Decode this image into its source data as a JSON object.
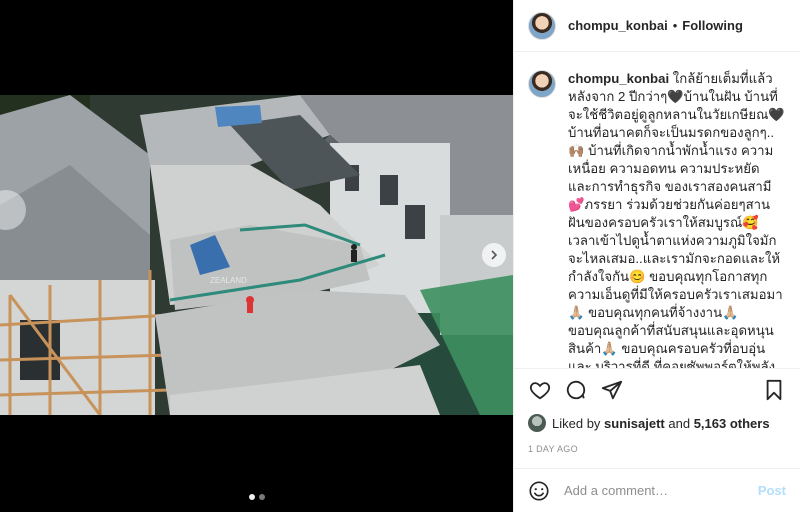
{
  "media": {
    "image_alt": "",
    "watermark": "ZEALAND"
  },
  "header": {
    "username": "chompu_konbai",
    "separator": "•",
    "follow_status": "Following"
  },
  "caption": {
    "username": "chompu_konbai",
    "text": " ใกล้ย้ายเต็มที่แล้วหลังจาก 2 ปีกว่าๆ🖤บ้านในฝัน บ้านที่จะใช้ชีวิตอยู่ดูลูกหลานในวัยเกษียณ🖤 บ้านที่อนาคตก็จะเป็นมรดกของลูกๆ.. 🙌🏽 บ้านที่เกิดจากน้ำพักน้ำแรง ความเหนื่อย ความอดทน ความประหยัด และการทำธุรกิจ ของเราสองคนสามี💕ภรรยา ร่วมด้วยช่วยกันค่อยๆสานฝันของครอบครัวเราให้สมบูรณ์🥰 เวลาเข้าไปดูน้ำตาแห่งความภูมิใจมักจะไหลเสมอ..และเรามักจะกอดและให้กำลังใจกัน😊 ขอบคุณทุกโอกาสทุกความเอ็นดูที่มีให้ครอบครัวเราเสมอมา🙏🏼 ขอบคุณทุกคนที่จ้างงาน🙏🏼 ขอบคุณลูกค้าที่สนับสนุนและอุดหนุนสินค้า🙏🏼 ขอบคุณครอบครัวที่อบอุ่น และ บริวารที่ดี ที่คอยซัพพอร์ตให้พลังแรงใจเสมอมา🙏🏼🙏🏼🙏🏼 สัญญาว่าจะพัฒนาตนเองอยู่เสมอ มีวินัย เมตตารู้จักการให้และแบ่งปันตลอดชีวิตที่เหลืออยู่นะจ๊ะ💋💋\nปล.ขอบคุณ🙏🏼 ภาพมุมสูงจากทีมตรวจบ้าน"
  },
  "actions": {
    "like": "heart-icon",
    "comment": "comment-icon",
    "share": "share-icon",
    "save": "bookmark-icon"
  },
  "likes": {
    "prefix": "Liked by",
    "user": "sunisajett",
    "middle": "and",
    "count": "5,163 others"
  },
  "timestamp": "1 DAY AGO",
  "comment_box": {
    "placeholder": "Add a comment…",
    "post_label": "Post"
  },
  "carousel": {
    "total": 2,
    "active_index": 0
  }
}
